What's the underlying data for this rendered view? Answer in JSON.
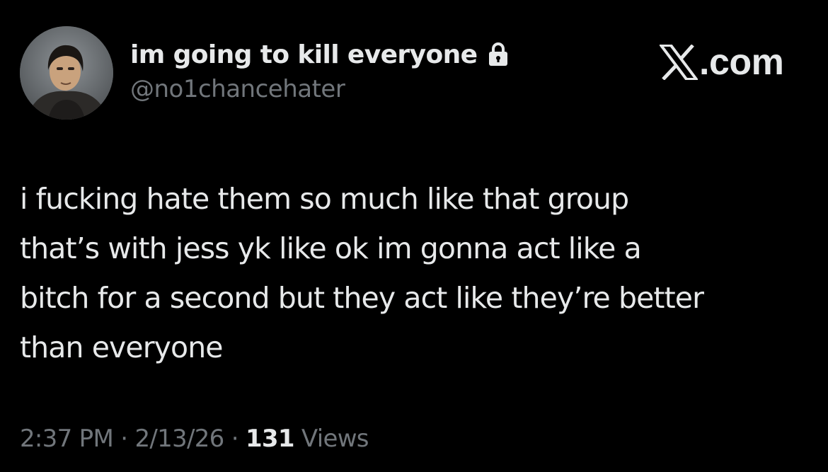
{
  "account": {
    "display_name": "im going to kill everyone",
    "handle": "@no1chancehater",
    "avatar_icon": "avatar-photo",
    "protected_icon": "lock-icon"
  },
  "brand": {
    "logo_icon": "x-logo-icon",
    "suffix": ".com"
  },
  "tweet": {
    "lines": [
      "i fucking hate them so much like that group",
      "that’s with jess yk like ok im gonna act like a",
      "bitch for a second but they act like they’re better",
      "than everyone"
    ]
  },
  "meta": {
    "time": "2:37 PM",
    "separator": "·",
    "date": "2/13/26",
    "views_count": "131",
    "views_label": "Views"
  },
  "colors": {
    "background": "#000000",
    "primary_text": "#e7e9ea",
    "secondary_text": "#71767b"
  }
}
